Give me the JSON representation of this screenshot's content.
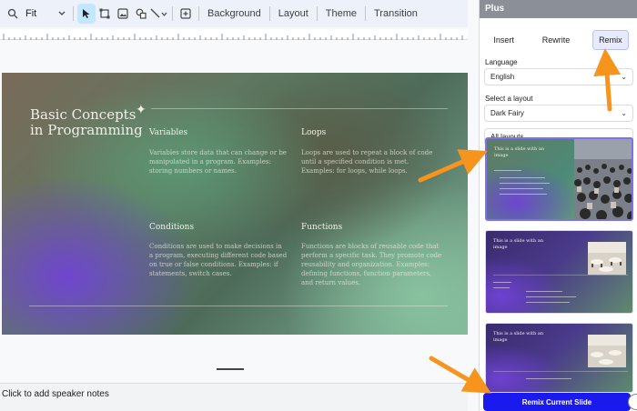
{
  "toolbar": {
    "zoom": "Fit",
    "background_label": "Background",
    "layout_label": "Layout",
    "theme_label": "Theme",
    "transition_label": "Transition"
  },
  "slide": {
    "title": "Basic Concepts in Programming",
    "topics": [
      {
        "heading": "Variables",
        "body": "Variables store data that can change or be manipulated in a program. Examples: storing numbers or names."
      },
      {
        "heading": "Loops",
        "body": "Loops are used to repeat a block of code until a specified condition is met. Examples: for loops, while loops."
      },
      {
        "heading": "Conditions",
        "body": "Conditions are used to make decisions in a program, executing different code based on true or false conditions. Examples: if statements, switch cases."
      },
      {
        "heading": "Functions",
        "body": "Functions are blocks of reusable code that perform a specific task. They promote code reusability and organization. Examples: defining functions, function parameters, and return values."
      }
    ]
  },
  "notes": {
    "placeholder": "Click to add speaker notes"
  },
  "panel": {
    "title": "Plus",
    "tabs": [
      "Insert",
      "Rewrite",
      "Remix"
    ],
    "active_tab": "Remix",
    "language_label": "Language",
    "language_value": "English",
    "layout_label": "Select a layout",
    "layout_value": "Dark Fairy",
    "filter_value": "All layouts",
    "thumbnails": [
      {
        "title": "This is a slide with an image"
      },
      {
        "title": "This is a slide with an image"
      },
      {
        "title": "This is a slide with an image"
      }
    ],
    "remix_button": "Remix Current Slide"
  },
  "colors": {
    "accent": "#1a1aee",
    "arrow": "#f7941d",
    "toolbar_bg": "#edf2fa",
    "selected_border": "#7b73e6"
  },
  "icons": [
    "search-icon",
    "undo-icon",
    "redo-icon",
    "print-icon",
    "cursor-icon",
    "select-frame-icon",
    "image-icon",
    "shape-icon",
    "line-icon",
    "add-comment-icon"
  ]
}
